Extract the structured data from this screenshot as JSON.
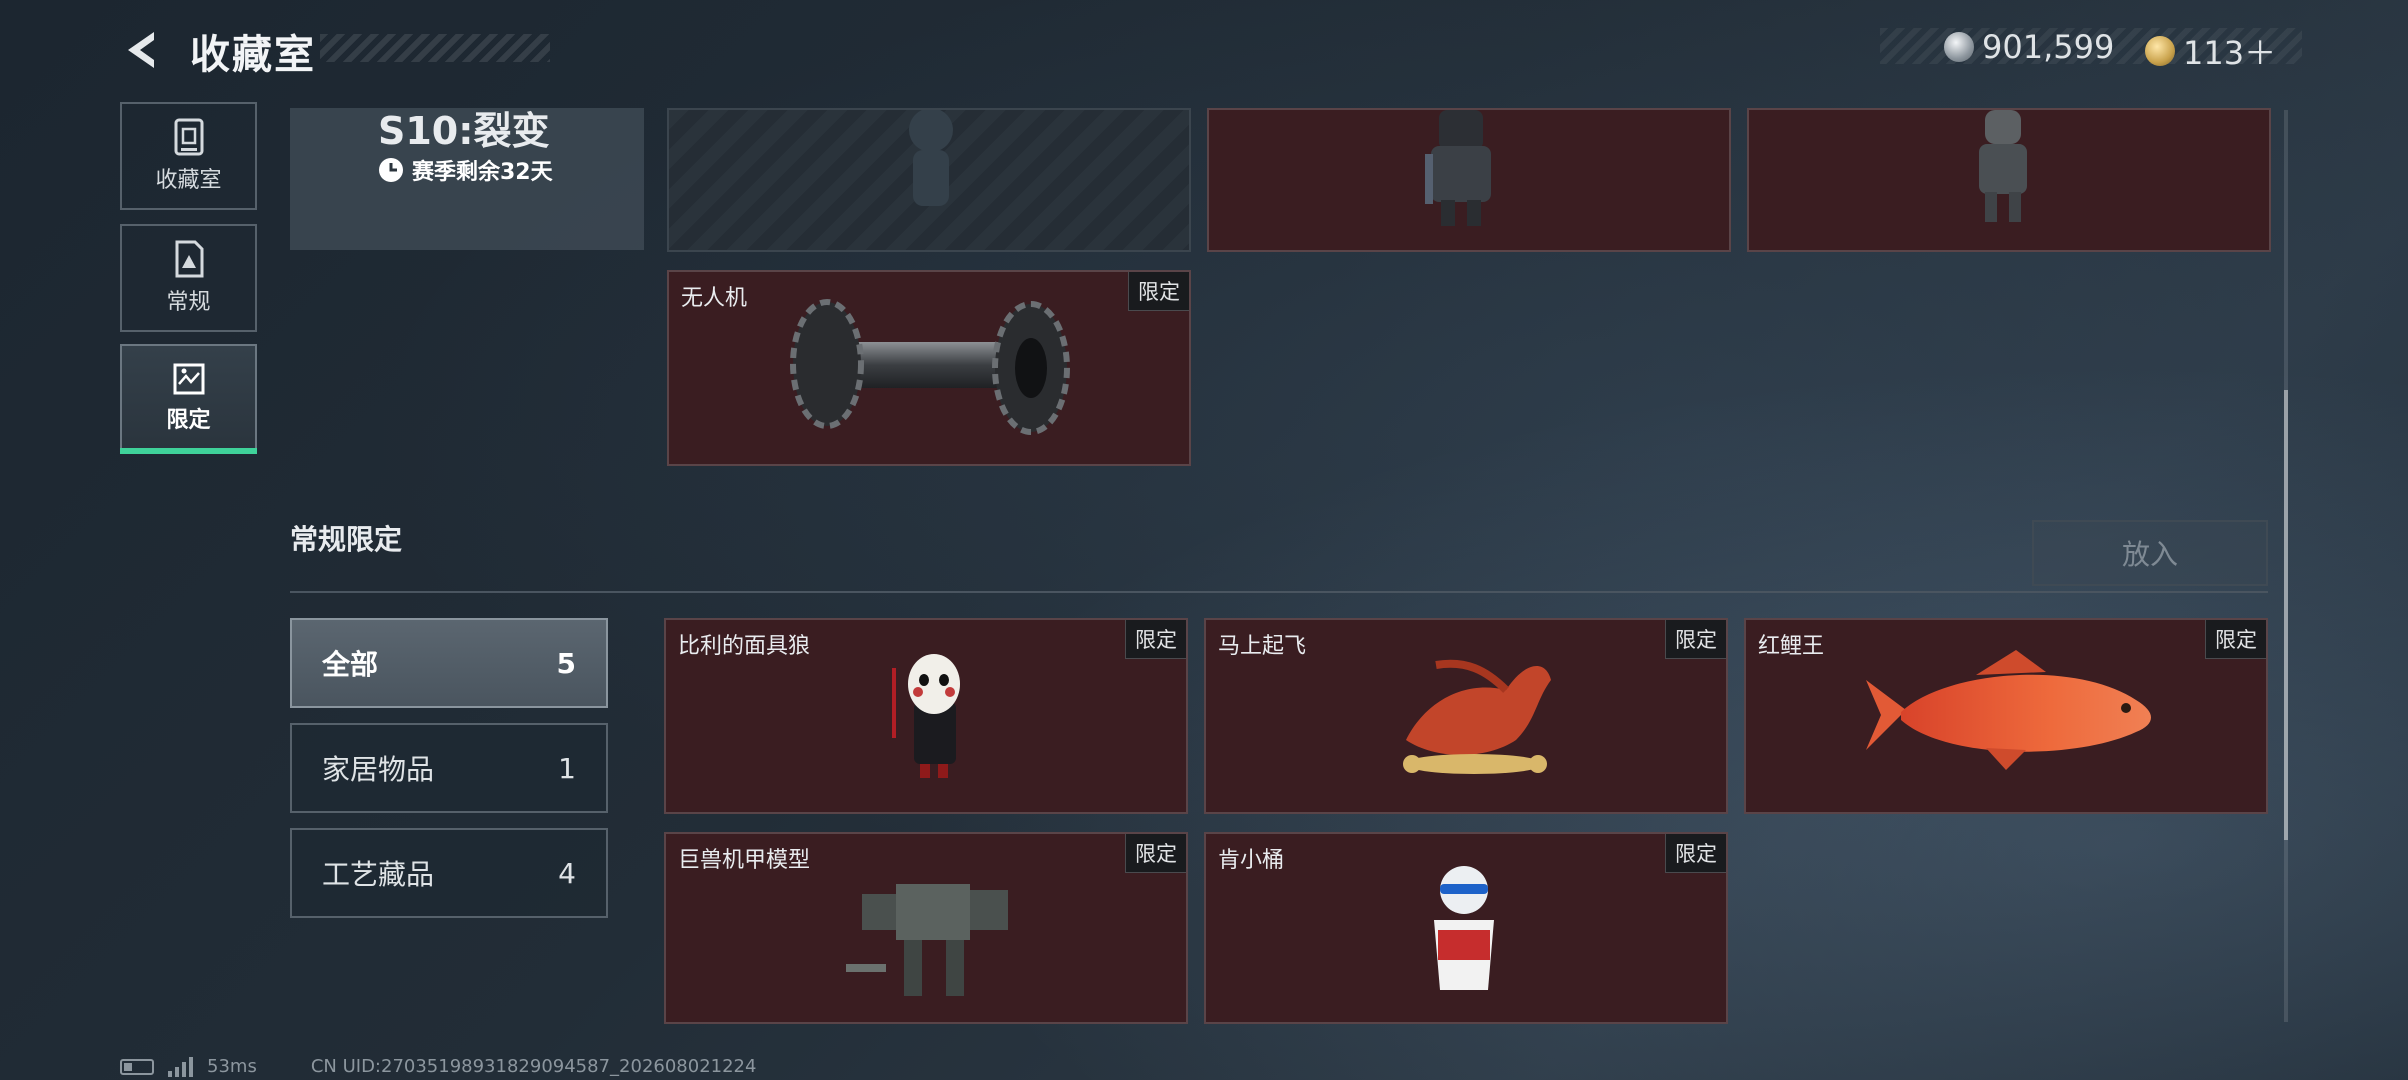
{
  "header": {
    "title": "收藏室",
    "currency": [
      {
        "icon": "silver-coin-icon",
        "value": "901,599"
      },
      {
        "icon": "gold-coin-icon",
        "value": "113＋"
      }
    ]
  },
  "nav": [
    {
      "label": "收藏室",
      "icon": "cabinet-icon",
      "active": false
    },
    {
      "label": "常规",
      "icon": "document-icon",
      "active": false
    },
    {
      "label": "限定",
      "icon": "map-icon",
      "active": true
    }
  ],
  "season": {
    "name": "S10:裂变",
    "remaining": "赛季剩余32天",
    "icon": "clock-icon"
  },
  "top_items": [
    {
      "name": "无人机",
      "badge": "限定"
    }
  ],
  "section": {
    "title": "常规限定",
    "put_button": "放入"
  },
  "filters": [
    {
      "label": "全部",
      "count": "5",
      "active": true
    },
    {
      "label": "家居物品",
      "count": "1",
      "active": false
    },
    {
      "label": "工艺藏品",
      "count": "4",
      "active": false
    }
  ],
  "items": [
    {
      "name": "比利的面具狼",
      "badge": "限定"
    },
    {
      "name": "马上起飞",
      "badge": "限定"
    },
    {
      "name": "红鲤王",
      "badge": "限定"
    },
    {
      "name": "巨兽机甲模型",
      "badge": "限定"
    },
    {
      "name": "肯小桶",
      "badge": "限定"
    }
  ],
  "footer": {
    "ping": "53ms",
    "uid": "CN UID:270351989318290945​87_202608021224"
  },
  "colors": {
    "accent": "#3fd29a",
    "card_bg": "#3a1d21"
  }
}
